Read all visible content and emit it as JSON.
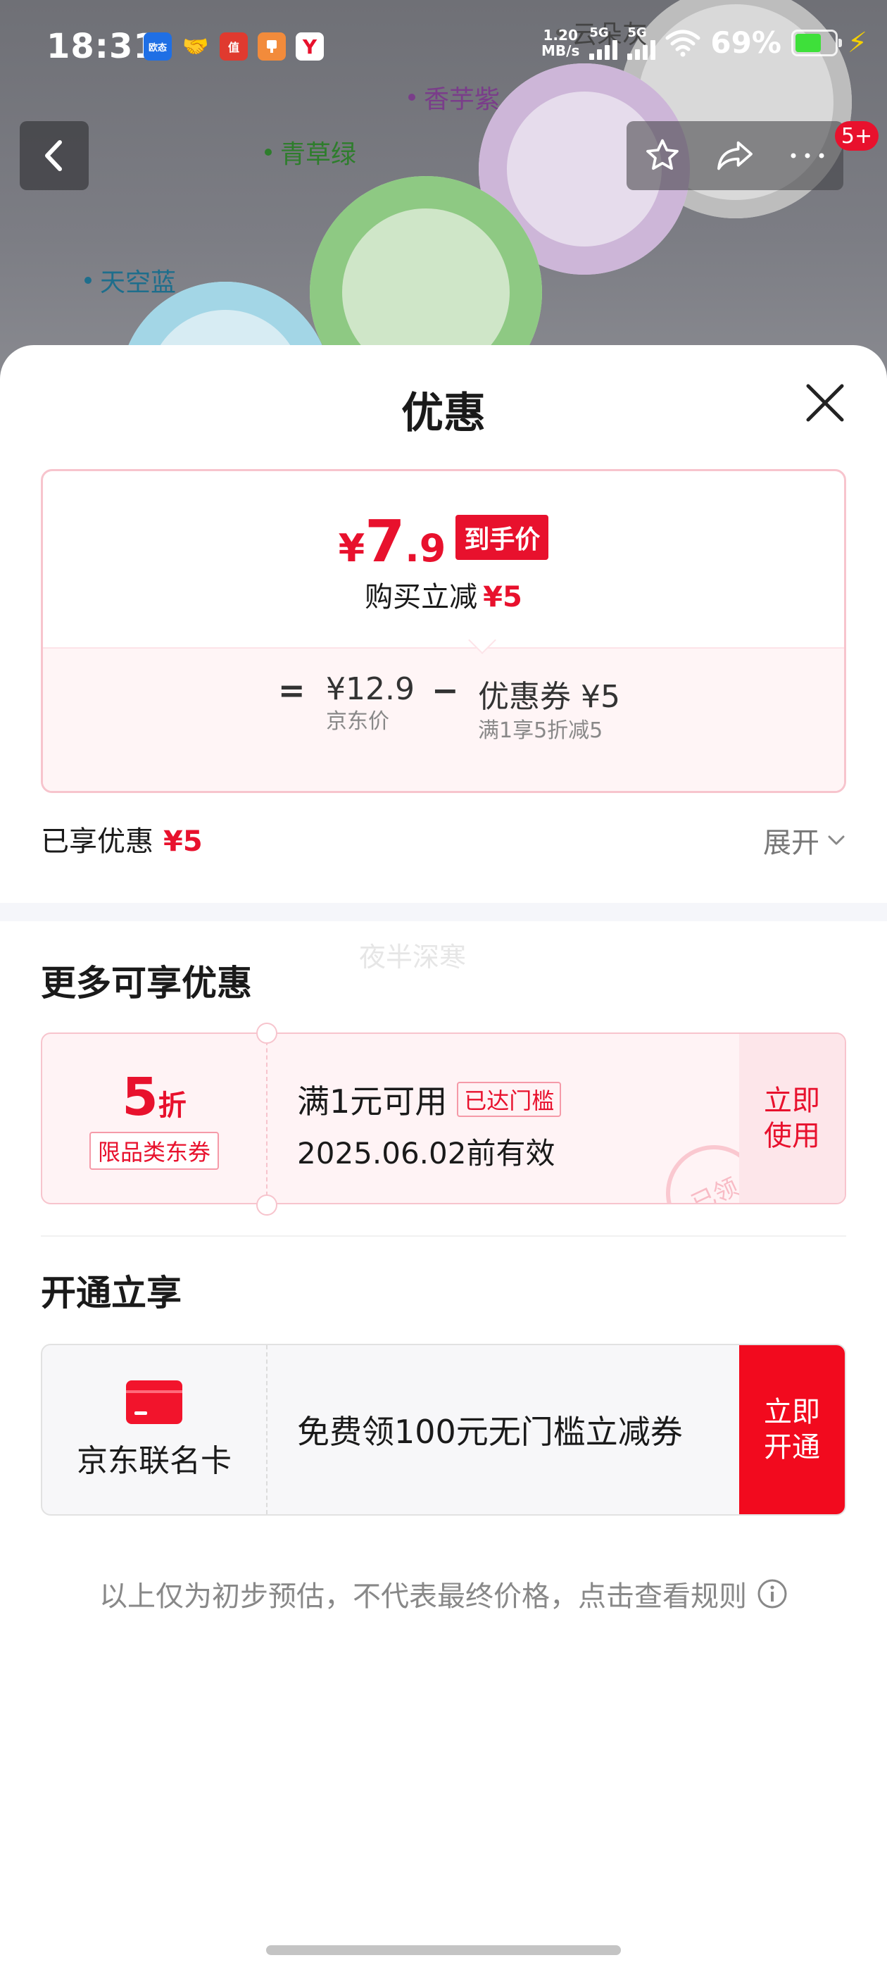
{
  "status_bar": {
    "time": "18:31",
    "net_speed_value": "1.20",
    "net_speed_unit": "MB/s",
    "sim1": "5G",
    "sim2": "5G",
    "battery_percent": "69%",
    "app_icons": [
      "欧态",
      "handshake",
      "值",
      "tag",
      "Y"
    ]
  },
  "background": {
    "color_labels": [
      "云朵灰",
      "香芋紫",
      "青草绿",
      "天空蓝"
    ]
  },
  "nav": {
    "badge_count": "5+"
  },
  "sheet": {
    "title": "优惠",
    "price_card": {
      "yen": "¥",
      "price_int": "7",
      "price_dec": ".9",
      "final_tag": "到手价",
      "reduce_label": "购买立减",
      "reduce_value": "¥5",
      "eq": "=",
      "jd_price": "¥12.9",
      "jd_price_label": "京东价",
      "minus": "−",
      "coupon_label": "优惠券 ¥5",
      "coupon_desc": "满1享5折减5"
    },
    "enjoyed_label": "已享优惠",
    "enjoyed_value": "¥5",
    "expand_label": "展开",
    "watermark": "夜半深寒",
    "more_title": "更多可享优惠",
    "coupon": {
      "discount_num": "5",
      "discount_unit": "折",
      "tag": "限品类东券",
      "condition": "满1元可用",
      "reached": "已达门槛",
      "validity": "2025.06.02前有效",
      "use_label": "立即使用",
      "stamp": "已领"
    },
    "open_title": "开通立享",
    "card": {
      "name": "京东联名卡",
      "desc": "免费领100元无门槛立减券",
      "open_label": "立即开通"
    },
    "disclaimer": "以上仅为初步预估，不代表最终价格，点击查看规则"
  },
  "colors": {
    "accent_red": "#e8112d",
    "button_red": "#f20a1e",
    "border_pink": "#f7c4cd"
  }
}
